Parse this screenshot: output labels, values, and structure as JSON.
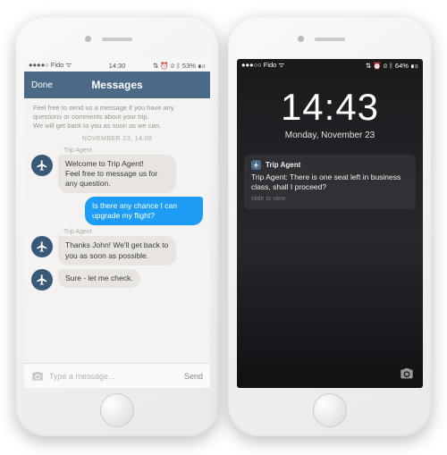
{
  "left": {
    "status": {
      "carrier": "●●●●○ Fido ᯤ",
      "time": "14:30",
      "extras": "⇅ ⏰ ⊘ ᛒ 53% ▮▯"
    },
    "nav": {
      "done": "Done",
      "title": "Messages"
    },
    "intro": "Feel free to send us a message if you have any questions or comments about your trip.\nWe will get back to you as soon as we can.",
    "timestamp": "NOVEMBER 23, 14:08",
    "sender_label": "Trip Agent",
    "messages": {
      "m1": "Welcome to Trip Agent!\nFeel free to message us for any question.",
      "m2": "Is there any chance I can upgrade my flight?",
      "m3": "Thanks John! We'll get back to you as soon as possible.",
      "m4": "Sure - let me check."
    },
    "composer": {
      "placeholder": "Type a message...",
      "send": "Send"
    }
  },
  "right": {
    "status": {
      "carrier": "●●●○○ Fido ᯤ",
      "extras": "⇅ ⏰ ⊘ ᛒ 64% ▮▯"
    },
    "clock": "14:43",
    "date": "Monday, November 23",
    "notification": {
      "app": "Trip Agent",
      "body": "Trip Agent: There is one seat left in business class, shall I proceed?",
      "slide": "slide to view"
    }
  }
}
